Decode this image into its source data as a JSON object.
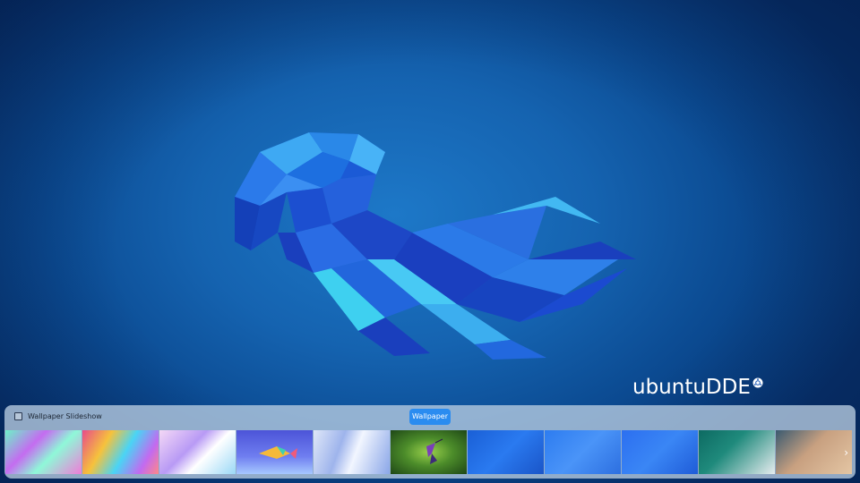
{
  "desktop": {
    "brand": "ubuntuDDE"
  },
  "dock_panel": {
    "slideshow_label": "Wallpaper Slideshow",
    "slideshow_checked": false,
    "wallpaper_button": "Wallpaper",
    "accent_color": "#2a8cf0",
    "thumbnails": [
      {
        "name": "wallpaper-thumb-1"
      },
      {
        "name": "wallpaper-thumb-2"
      },
      {
        "name": "wallpaper-thumb-3"
      },
      {
        "name": "wallpaper-thumb-4"
      },
      {
        "name": "wallpaper-thumb-5"
      },
      {
        "name": "wallpaper-thumb-6"
      },
      {
        "name": "wallpaper-thumb-7"
      },
      {
        "name": "wallpaper-thumb-8"
      },
      {
        "name": "wallpaper-thumb-9"
      },
      {
        "name": "wallpaper-thumb-10"
      },
      {
        "name": "wallpaper-thumb-11"
      }
    ],
    "next_icon": "chevron-right-icon"
  }
}
